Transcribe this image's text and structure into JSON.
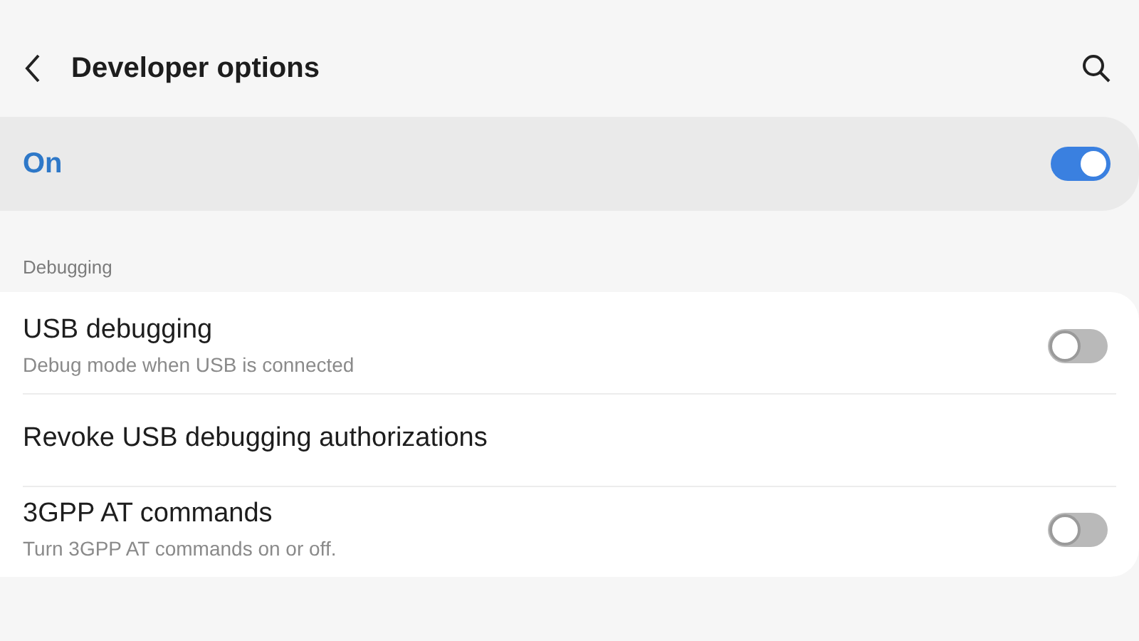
{
  "header": {
    "title": "Developer options"
  },
  "master": {
    "label": "On",
    "on": true
  },
  "section": {
    "title": "Debugging"
  },
  "items": [
    {
      "kind": "switch",
      "title": "USB debugging",
      "subtitle": "Debug mode when USB is connected",
      "on": false
    },
    {
      "kind": "action",
      "title": "Revoke USB debugging authorizations"
    },
    {
      "kind": "switch",
      "title": "3GPP AT commands",
      "subtitle": "Turn 3GPP AT commands on or off.",
      "on": false
    }
  ]
}
